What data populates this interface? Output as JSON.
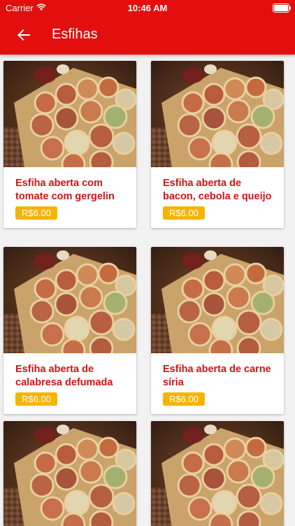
{
  "status": {
    "carrier": "Carrier",
    "time": "10:46 AM"
  },
  "header": {
    "title": "Esfihas",
    "back_icon": "arrow-back-icon"
  },
  "colors": {
    "primary": "#e30f0f",
    "price_badge": "#f6b400",
    "name_text": "#d21414"
  },
  "products": [
    {
      "name": "Esfiha aberta com tomate com gergelin",
      "price": "R$6.00"
    },
    {
      "name": "Esfiha aberta de bacon, cebola e queijo",
      "price": "R$6.00"
    },
    {
      "name": "Esfiha aberta de calabresa defumada",
      "price": "R$6.00"
    },
    {
      "name": "Esfiha aberta de carne síria",
      "price": "R$6.00"
    },
    {
      "name": "",
      "price": ""
    },
    {
      "name": "",
      "price": ""
    }
  ]
}
